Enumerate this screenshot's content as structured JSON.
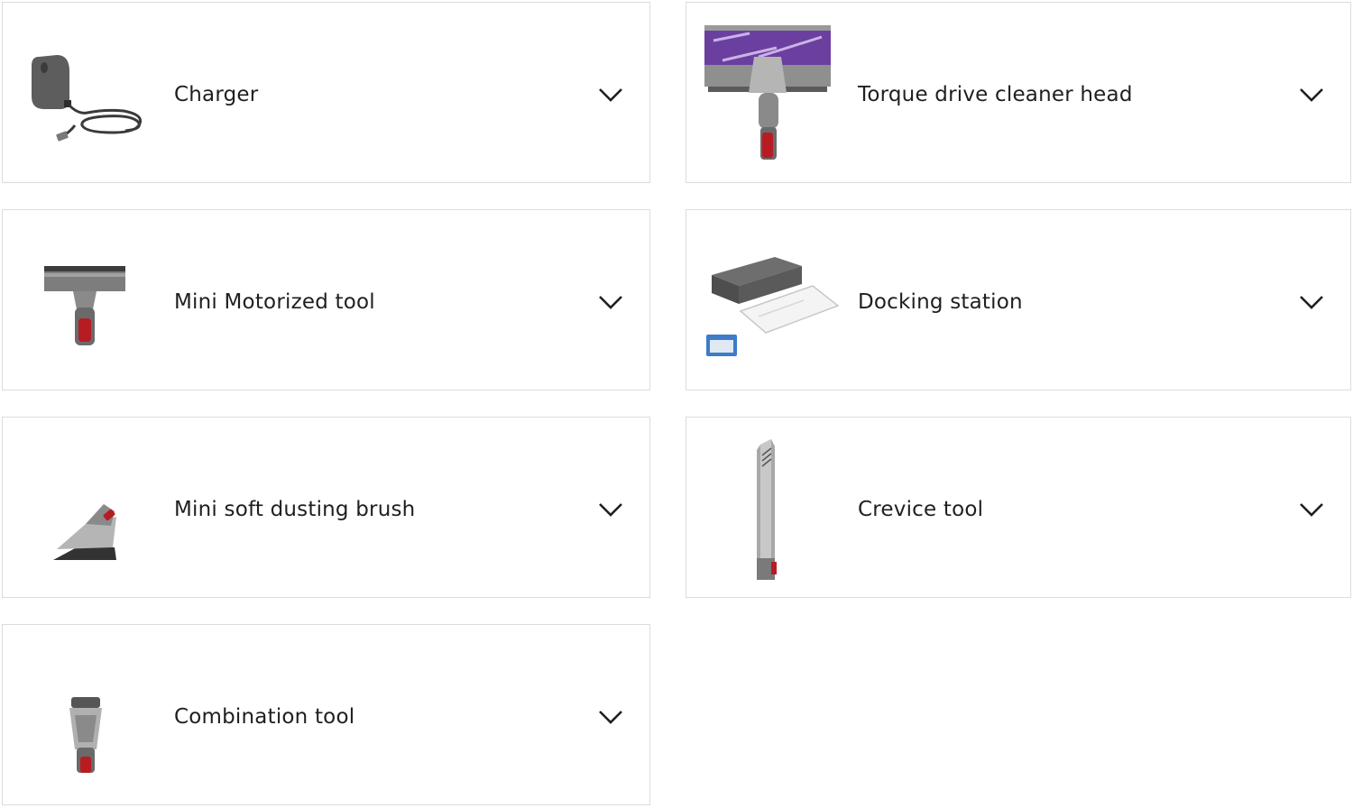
{
  "accessories": [
    {
      "label": "Charger",
      "icon": "charger-icon"
    },
    {
      "label": "Torque drive cleaner head",
      "icon": "cleaner-head-icon"
    },
    {
      "label": "Mini Motorized tool",
      "icon": "mini-motorized-tool-icon"
    },
    {
      "label": "Docking station",
      "icon": "docking-station-icon"
    },
    {
      "label": "Mini soft dusting brush",
      "icon": "dusting-brush-icon"
    },
    {
      "label": "Crevice tool",
      "icon": "crevice-tool-icon"
    },
    {
      "label": "Combination tool",
      "icon": "combination-tool-icon"
    }
  ],
  "toggle_icon": "chevron-down-icon",
  "colors": {
    "accent": "#b81c23",
    "border": "#dcdcdc",
    "purple": "#6b3fa0",
    "metal": "#8f8f8f"
  }
}
